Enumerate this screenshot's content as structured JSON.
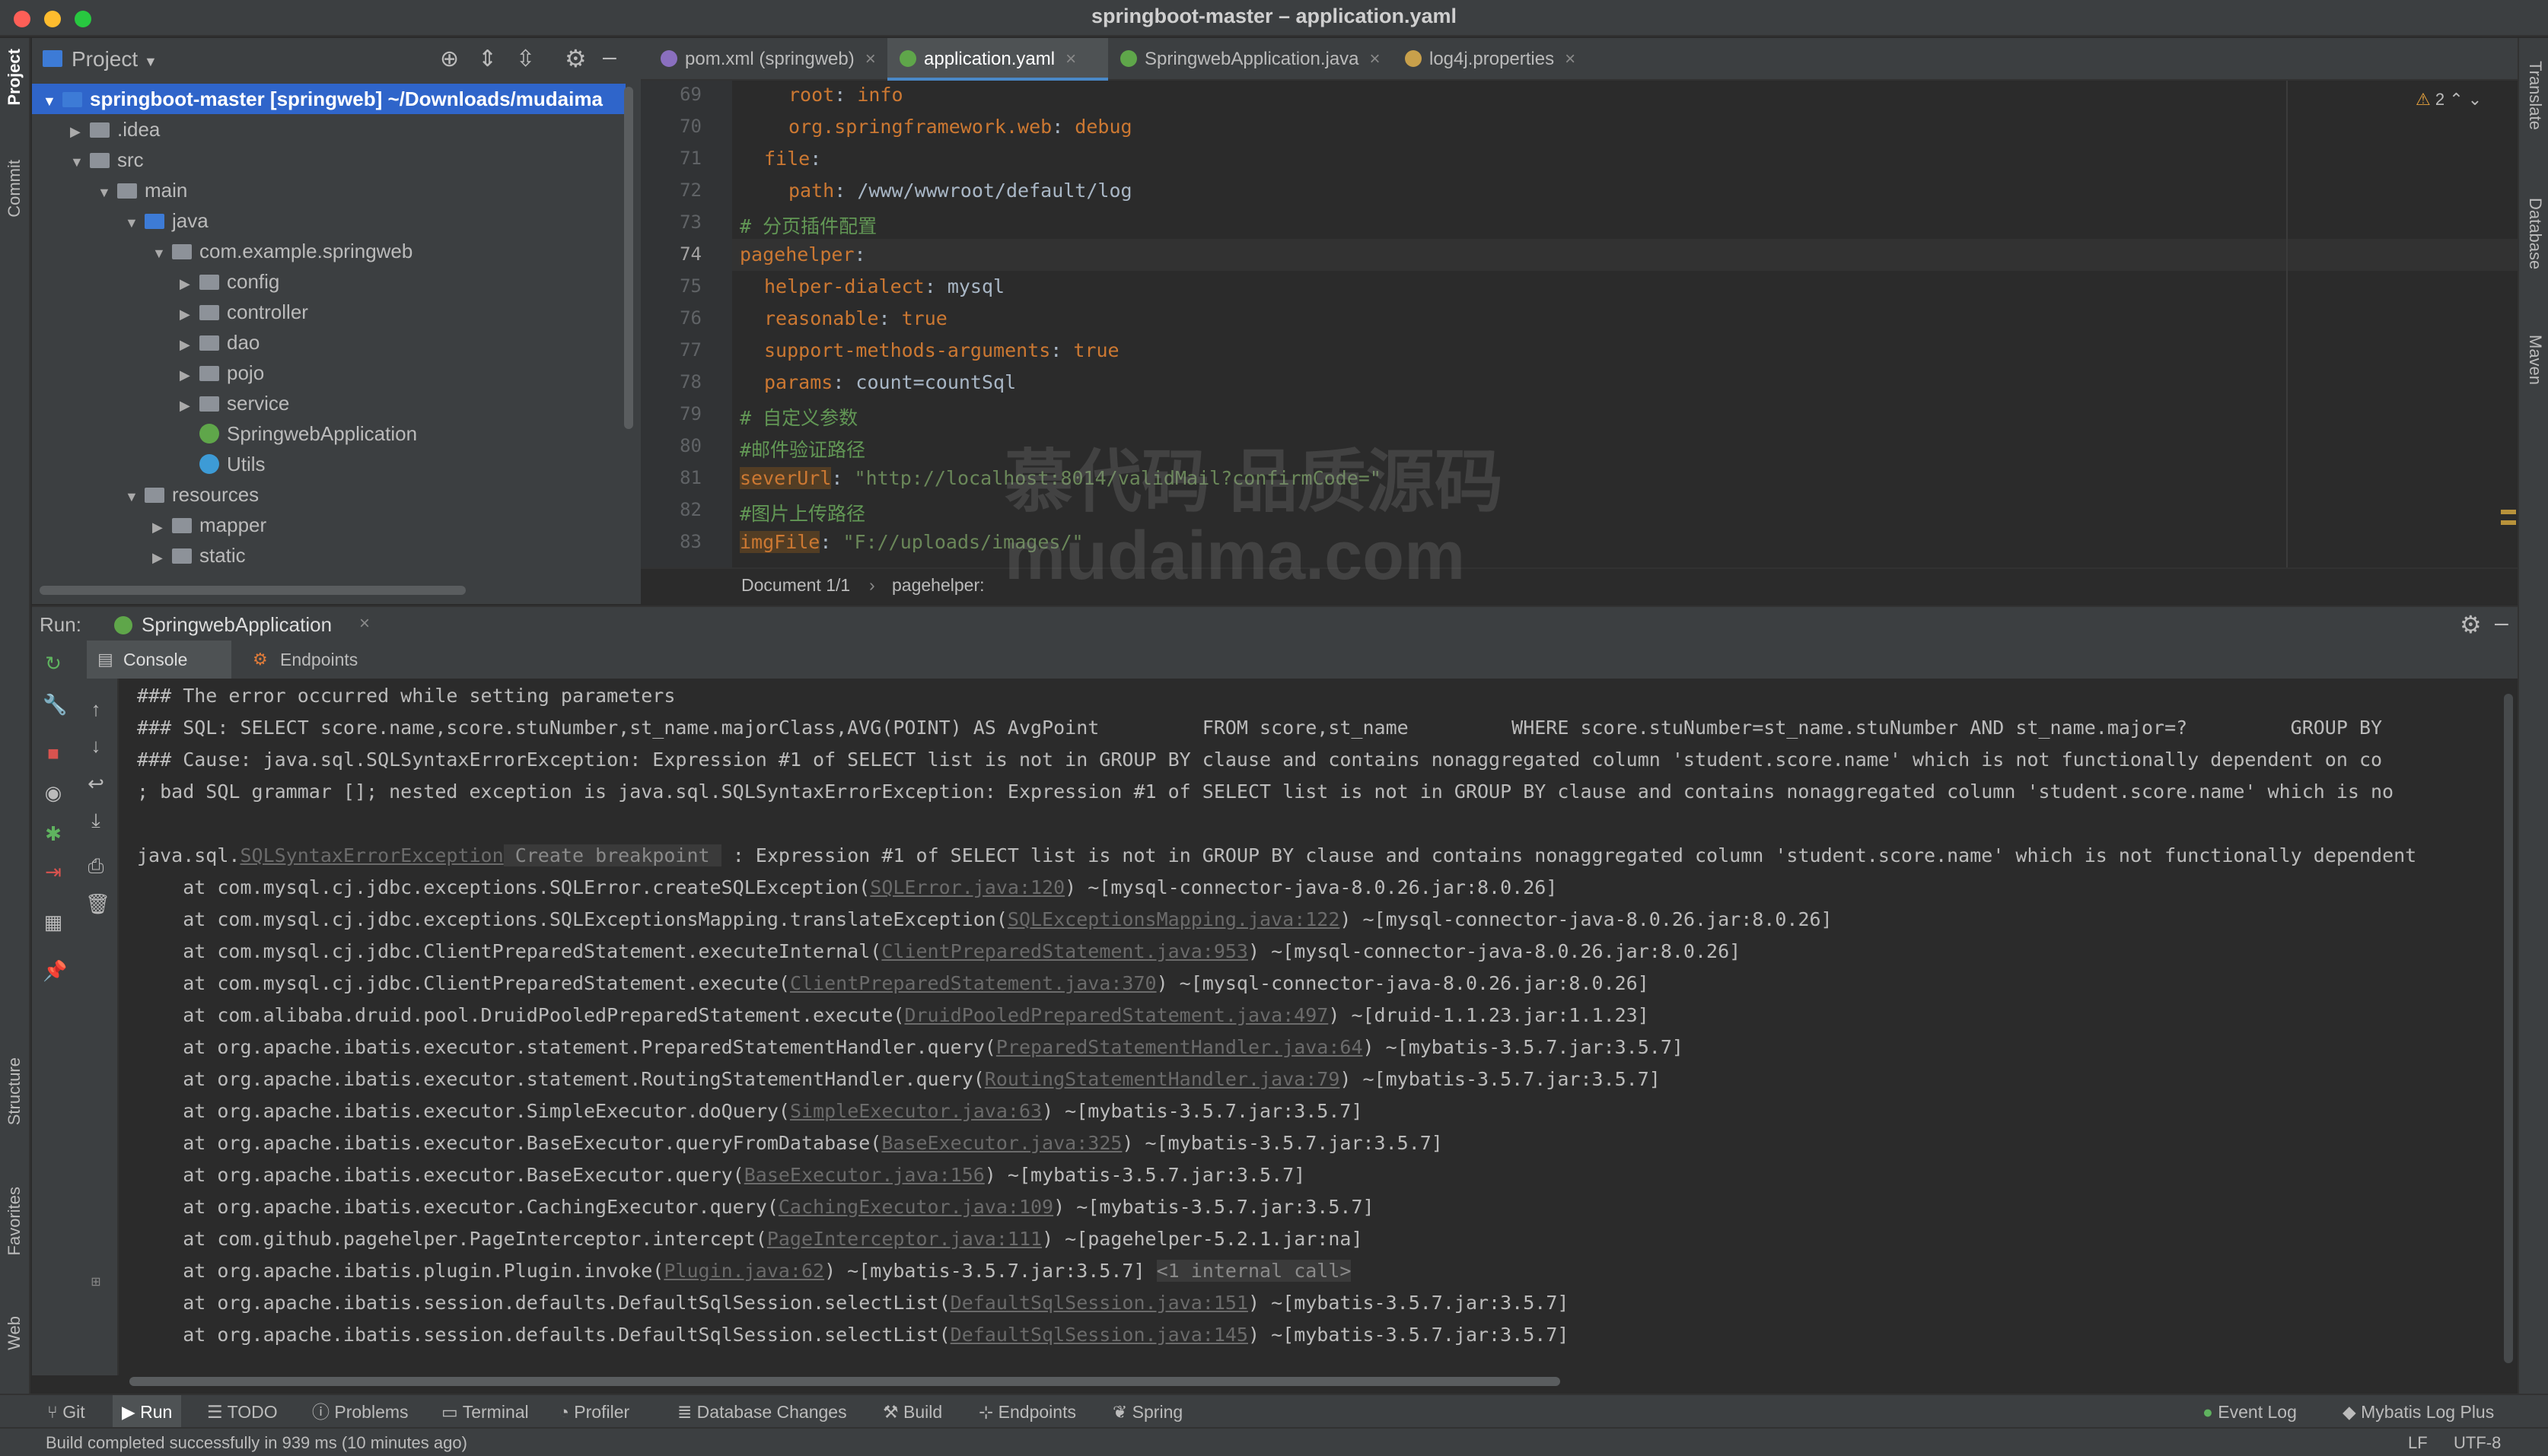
{
  "window": {
    "title": "springboot-master – application.yaml"
  },
  "left_strip": {
    "project": "Project",
    "commit": "Commit",
    "structure": "Structure",
    "favorites": "Favorites",
    "web": "Web"
  },
  "right_strip": {
    "translate": "Translate",
    "database": "Database",
    "maven": "Maven"
  },
  "project": {
    "title": "Project",
    "tree": [
      {
        "label": "springboot-master [springweb] ~/Downloads/mudaima",
        "depth": 0,
        "exp": "open",
        "icon": "folder-blue",
        "selected": true
      },
      {
        "label": ".idea",
        "depth": 1,
        "exp": "closed",
        "icon": "folder"
      },
      {
        "label": "src",
        "depth": 1,
        "exp": "open",
        "icon": "folder"
      },
      {
        "label": "main",
        "depth": 2,
        "exp": "open",
        "icon": "folder"
      },
      {
        "label": "java",
        "depth": 3,
        "exp": "open",
        "icon": "folder-blue"
      },
      {
        "label": "com.example.springweb",
        "depth": 4,
        "exp": "open",
        "icon": "folder"
      },
      {
        "label": "config",
        "depth": 5,
        "exp": "closed",
        "icon": "folder"
      },
      {
        "label": "controller",
        "depth": 5,
        "exp": "closed",
        "icon": "folder"
      },
      {
        "label": "dao",
        "depth": 5,
        "exp": "closed",
        "icon": "folder"
      },
      {
        "label": "pojo",
        "depth": 5,
        "exp": "closed",
        "icon": "folder"
      },
      {
        "label": "service",
        "depth": 5,
        "exp": "closed",
        "icon": "folder"
      },
      {
        "label": "SpringwebApplication",
        "depth": 5,
        "exp": "none",
        "icon": "spring-class"
      },
      {
        "label": "Utils",
        "depth": 5,
        "exp": "none",
        "icon": "class"
      },
      {
        "label": "resources",
        "depth": 3,
        "exp": "open",
        "icon": "folder"
      },
      {
        "label": "mapper",
        "depth": 4,
        "exp": "closed",
        "icon": "folder"
      },
      {
        "label": "static",
        "depth": 4,
        "exp": "closed",
        "icon": "folder"
      }
    ]
  },
  "editor": {
    "tabs": [
      {
        "label": "pom.xml (springweb)",
        "active": false,
        "icon": "m"
      },
      {
        "label": "application.yaml",
        "active": true,
        "icon": "yaml"
      },
      {
        "label": "SpringwebApplication.java",
        "active": false,
        "icon": "spring"
      },
      {
        "label": "log4j.properties",
        "active": false,
        "icon": "props"
      }
    ],
    "warnings": "2",
    "lines": [
      {
        "n": "69",
        "ind": 2,
        "parts": [
          [
            "k",
            "root"
          ],
          [
            "v",
            ": "
          ],
          [
            "k",
            "info"
          ]
        ]
      },
      {
        "n": "70",
        "ind": 2,
        "parts": [
          [
            "k",
            "org.springframework.web"
          ],
          [
            "v",
            ": "
          ],
          [
            "k",
            "debug"
          ]
        ]
      },
      {
        "n": "71",
        "ind": 1,
        "parts": [
          [
            "k",
            "file"
          ],
          [
            "v",
            ":"
          ]
        ]
      },
      {
        "n": "72",
        "ind": 2,
        "parts": [
          [
            "k",
            "path"
          ],
          [
            "v",
            ": /www/wwwroot/default/log"
          ]
        ]
      },
      {
        "n": "73",
        "ind": 0,
        "parts": [
          [
            "cm",
            "# 分页插件配置"
          ]
        ]
      },
      {
        "n": "74",
        "ind": 0,
        "parts": [
          [
            "k",
            "pagehelper"
          ],
          [
            "v",
            ":"
          ]
        ]
      },
      {
        "n": "75",
        "ind": 1,
        "parts": [
          [
            "k",
            "helper-dialect"
          ],
          [
            "v",
            ": mysql"
          ]
        ]
      },
      {
        "n": "76",
        "ind": 1,
        "parts": [
          [
            "k",
            "reasonable"
          ],
          [
            "v",
            ": "
          ],
          [
            "k",
            "true"
          ]
        ]
      },
      {
        "n": "77",
        "ind": 1,
        "parts": [
          [
            "k",
            "support-methods-arguments"
          ],
          [
            "v",
            ": "
          ],
          [
            "k",
            "true"
          ]
        ]
      },
      {
        "n": "78",
        "ind": 1,
        "parts": [
          [
            "k",
            "params"
          ],
          [
            "v",
            ": count=countSql"
          ]
        ]
      },
      {
        "n": "79",
        "ind": 0,
        "parts": [
          [
            "cm",
            "# 自定义参数"
          ]
        ]
      },
      {
        "n": "80",
        "ind": 0,
        "parts": [
          [
            "cm",
            "#邮件验证路径"
          ]
        ]
      },
      {
        "n": "81",
        "ind": 0,
        "parts": [
          [
            "hl",
            "severUrl"
          ],
          [
            "v",
            ": "
          ],
          [
            "str",
            "\"http://localhost:8014/validMail?confirmCode=\""
          ]
        ]
      },
      {
        "n": "82",
        "ind": 0,
        "parts": [
          [
            "cm",
            "#图片上传路径"
          ]
        ]
      },
      {
        "n": "83",
        "ind": 0,
        "parts": [
          [
            "hl",
            "imgFile"
          ],
          [
            "v",
            ": "
          ],
          [
            "str",
            "\"F://uploads/images/\""
          ]
        ]
      }
    ],
    "breadcrumb": [
      "Document 1/1",
      "pagehelper:"
    ]
  },
  "run": {
    "label": "Run:",
    "config": "SpringwebApplication",
    "tabs": [
      "Console",
      "Endpoints"
    ],
    "lines": [
      [
        [
          "t",
          "### The error occurred while setting parameters"
        ]
      ],
      [
        [
          "t",
          "### SQL: SELECT score.name,score.stuNumber,st_name.majorClass,AVG(POINT) AS AvgPoint         FROM score,st_name         WHERE score.stuNumber=st_name.stuNumber AND st_name.major=?         GROUP BY"
        ]
      ],
      [
        [
          "t",
          "### Cause: java.sql.SQLSyntaxErrorException: Expression #1 of SELECT list is not in GROUP BY clause and contains nonaggregated column 'student.score.name' which is not functionally dependent on co"
        ]
      ],
      [
        [
          "t",
          "; bad SQL grammar []; nested exception is java.sql.SQLSyntaxErrorException: Expression #1 of SELECT list is not in GROUP BY clause and contains nonaggregated column 'student.score.name' which is no"
        ]
      ],
      [
        [
          "t",
          ""
        ]
      ],
      [
        [
          "t",
          "java.sql."
        ],
        [
          "l",
          "SQLSyntaxErrorException"
        ],
        [
          "d",
          " Create breakpoint "
        ],
        [
          "t",
          " : Expression #1 of SELECT list is not in GROUP BY clause and contains nonaggregated column 'student.score.name' which is not functionally dependent"
        ]
      ],
      [
        [
          "t",
          "    at com.mysql.cj.jdbc.exceptions.SQLError.createSQLException("
        ],
        [
          "l",
          "SQLError.java:120"
        ],
        [
          "t",
          ") ~[mysql-connector-java-8.0.26.jar:8.0.26]"
        ]
      ],
      [
        [
          "t",
          "    at com.mysql.cj.jdbc.exceptions.SQLExceptionsMapping.translateException("
        ],
        [
          "l",
          "SQLExceptionsMapping.java:122"
        ],
        [
          "t",
          ") ~[mysql-connector-java-8.0.26.jar:8.0.26]"
        ]
      ],
      [
        [
          "t",
          "    at com.mysql.cj.jdbc.ClientPreparedStatement.executeInternal("
        ],
        [
          "l",
          "ClientPreparedStatement.java:953"
        ],
        [
          "t",
          ") ~[mysql-connector-java-8.0.26.jar:8.0.26]"
        ]
      ],
      [
        [
          "t",
          "    at com.mysql.cj.jdbc.ClientPreparedStatement.execute("
        ],
        [
          "l",
          "ClientPreparedStatement.java:370"
        ],
        [
          "t",
          ") ~[mysql-connector-java-8.0.26.jar:8.0.26]"
        ]
      ],
      [
        [
          "t",
          "    at com.alibaba.druid.pool.DruidPooledPreparedStatement.execute("
        ],
        [
          "l",
          "DruidPooledPreparedStatement.java:497"
        ],
        [
          "t",
          ") ~[druid-1.1.23.jar:1.1.23]"
        ]
      ],
      [
        [
          "t",
          "    at org.apache.ibatis.executor.statement.PreparedStatementHandler.query("
        ],
        [
          "l",
          "PreparedStatementHandler.java:64"
        ],
        [
          "t",
          ") ~[mybatis-3.5.7.jar:3.5.7]"
        ]
      ],
      [
        [
          "t",
          "    at org.apache.ibatis.executor.statement.RoutingStatementHandler.query("
        ],
        [
          "l",
          "RoutingStatementHandler.java:79"
        ],
        [
          "t",
          ") ~[mybatis-3.5.7.jar:3.5.7]"
        ]
      ],
      [
        [
          "t",
          "    at org.apache.ibatis.executor.SimpleExecutor.doQuery("
        ],
        [
          "l",
          "SimpleExecutor.java:63"
        ],
        [
          "t",
          ") ~[mybatis-3.5.7.jar:3.5.7]"
        ]
      ],
      [
        [
          "t",
          "    at org.apache.ibatis.executor.BaseExecutor.queryFromDatabase("
        ],
        [
          "l",
          "BaseExecutor.java:325"
        ],
        [
          "t",
          ") ~[mybatis-3.5.7.jar:3.5.7]"
        ]
      ],
      [
        [
          "t",
          "    at org.apache.ibatis.executor.BaseExecutor.query("
        ],
        [
          "l",
          "BaseExecutor.java:156"
        ],
        [
          "t",
          ") ~[mybatis-3.5.7.jar:3.5.7]"
        ]
      ],
      [
        [
          "t",
          "    at org.apache.ibatis.executor.CachingExecutor.query("
        ],
        [
          "l",
          "CachingExecutor.java:109"
        ],
        [
          "t",
          ") ~[mybatis-3.5.7.jar:3.5.7]"
        ]
      ],
      [
        [
          "t",
          "    at com.github.pagehelper.PageInterceptor.intercept("
        ],
        [
          "l",
          "PageInterceptor.java:111"
        ],
        [
          "t",
          ") ~[pagehelper-5.2.1.jar:na]"
        ]
      ],
      [
        [
          "t",
          "    at org.apache.ibatis.plugin.Plugin.invoke("
        ],
        [
          "l",
          "Plugin.java:62"
        ],
        [
          "t",
          ") ~[mybatis-3.5.7.jar:3.5.7] "
        ],
        [
          "d",
          "<1 internal call>"
        ]
      ],
      [
        [
          "t",
          "    at org.apache.ibatis.session.defaults.DefaultSqlSession.selectList("
        ],
        [
          "l",
          "DefaultSqlSession.java:151"
        ],
        [
          "t",
          ") ~[mybatis-3.5.7.jar:3.5.7]"
        ]
      ],
      [
        [
          "t",
          "    at org.apache.ibatis.session.defaults.DefaultSqlSession.selectList("
        ],
        [
          "l",
          "DefaultSqlSession.java:145"
        ],
        [
          "t",
          ") ~[mybatis-3.5.7.jar:3.5.7]"
        ]
      ]
    ]
  },
  "bottom": {
    "left": [
      "Git",
      "Run",
      "TODO",
      "Problems",
      "Terminal",
      "Profiler",
      "Database Changes",
      "Build",
      "Endpoints",
      "Spring"
    ],
    "right": [
      "Event Log",
      "Mybatis Log Plus"
    ]
  },
  "status": {
    "message": "Build completed successfully in 939 ms (10 minutes ago)",
    "lf": "LF",
    "enc": "UTF-8"
  },
  "watermark": {
    "cn": "慕代码 品质源码",
    "en": "mudaima.com"
  }
}
